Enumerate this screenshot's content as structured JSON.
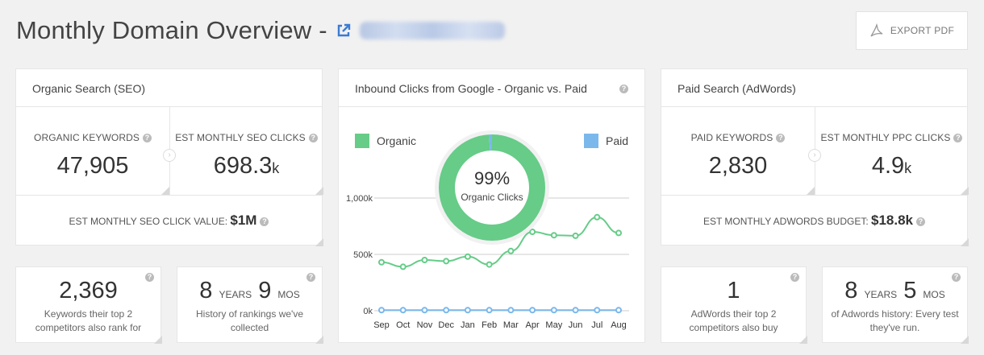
{
  "header": {
    "title": "Monthly Domain Overview -",
    "export_label": "EXPORT PDF"
  },
  "seo": {
    "title": "Organic Search (SEO)",
    "keywords_label": "ORGANIC KEYWORDS",
    "keywords_value": "47,905",
    "clicks_label": "EST MONTHLY SEO CLICKS",
    "clicks_value": "698.3",
    "clicks_suffix": "k",
    "click_value_label": "EST MONTHLY SEO CLICK VALUE:",
    "click_value": "$1M"
  },
  "chart_card": {
    "title": "Inbound Clicks from Google - Organic vs. Paid",
    "donut_pct": "99%",
    "donut_label": "Organic Clicks"
  },
  "paid": {
    "title": "Paid Search (AdWords)",
    "keywords_label": "PAID KEYWORDS",
    "keywords_value": "2,830",
    "clicks_label": "EST MONTHLY PPC CLICKS",
    "clicks_value": "4.9",
    "clicks_suffix": "k",
    "budget_label": "EST MONTHLY ADWORDS BUDGET:",
    "budget_value": "$18.8k"
  },
  "mini": {
    "competitor_kw": {
      "value": "2,369",
      "desc": "Keywords their top 2 competitors also rank for"
    },
    "seo_history": {
      "years": "8",
      "years_unit": "YEARS",
      "months": "9",
      "months_unit": "MOS",
      "desc": "History of rankings we've collected"
    },
    "adwords_comp": {
      "value": "1",
      "desc": "AdWords their top 2 competitors also buy"
    },
    "adwords_history": {
      "years": "8",
      "years_unit": "YEARS",
      "months": "5",
      "months_unit": "MOS",
      "desc": "of Adwords history: Every test they've run."
    }
  },
  "colors": {
    "organic": "#66cc88",
    "paid": "#7ab8ec",
    "link": "#3a7bd5"
  },
  "chart_data": {
    "type": "line",
    "categories": [
      "Sep",
      "Oct",
      "Nov",
      "Dec",
      "Jan",
      "Feb",
      "Mar",
      "Apr",
      "May",
      "Jun",
      "Jul",
      "Aug"
    ],
    "y_ticks": [
      "0k",
      "500k",
      "1,000k"
    ],
    "ylim": [
      0,
      1000000
    ],
    "grid": true,
    "legend": "top",
    "series": [
      {
        "name": "Organic",
        "values": [
          430000,
          390000,
          450000,
          440000,
          480000,
          410000,
          530000,
          700000,
          670000,
          665000,
          830000,
          690000
        ]
      },
      {
        "name": "Paid",
        "values": [
          5000,
          5000,
          5000,
          5000,
          5000,
          5000,
          5000,
          5000,
          5000,
          5000,
          5000,
          5000
        ]
      }
    ],
    "donut": [
      {
        "name": "Organic",
        "value": 99
      },
      {
        "name": "Paid",
        "value": 1
      }
    ]
  }
}
